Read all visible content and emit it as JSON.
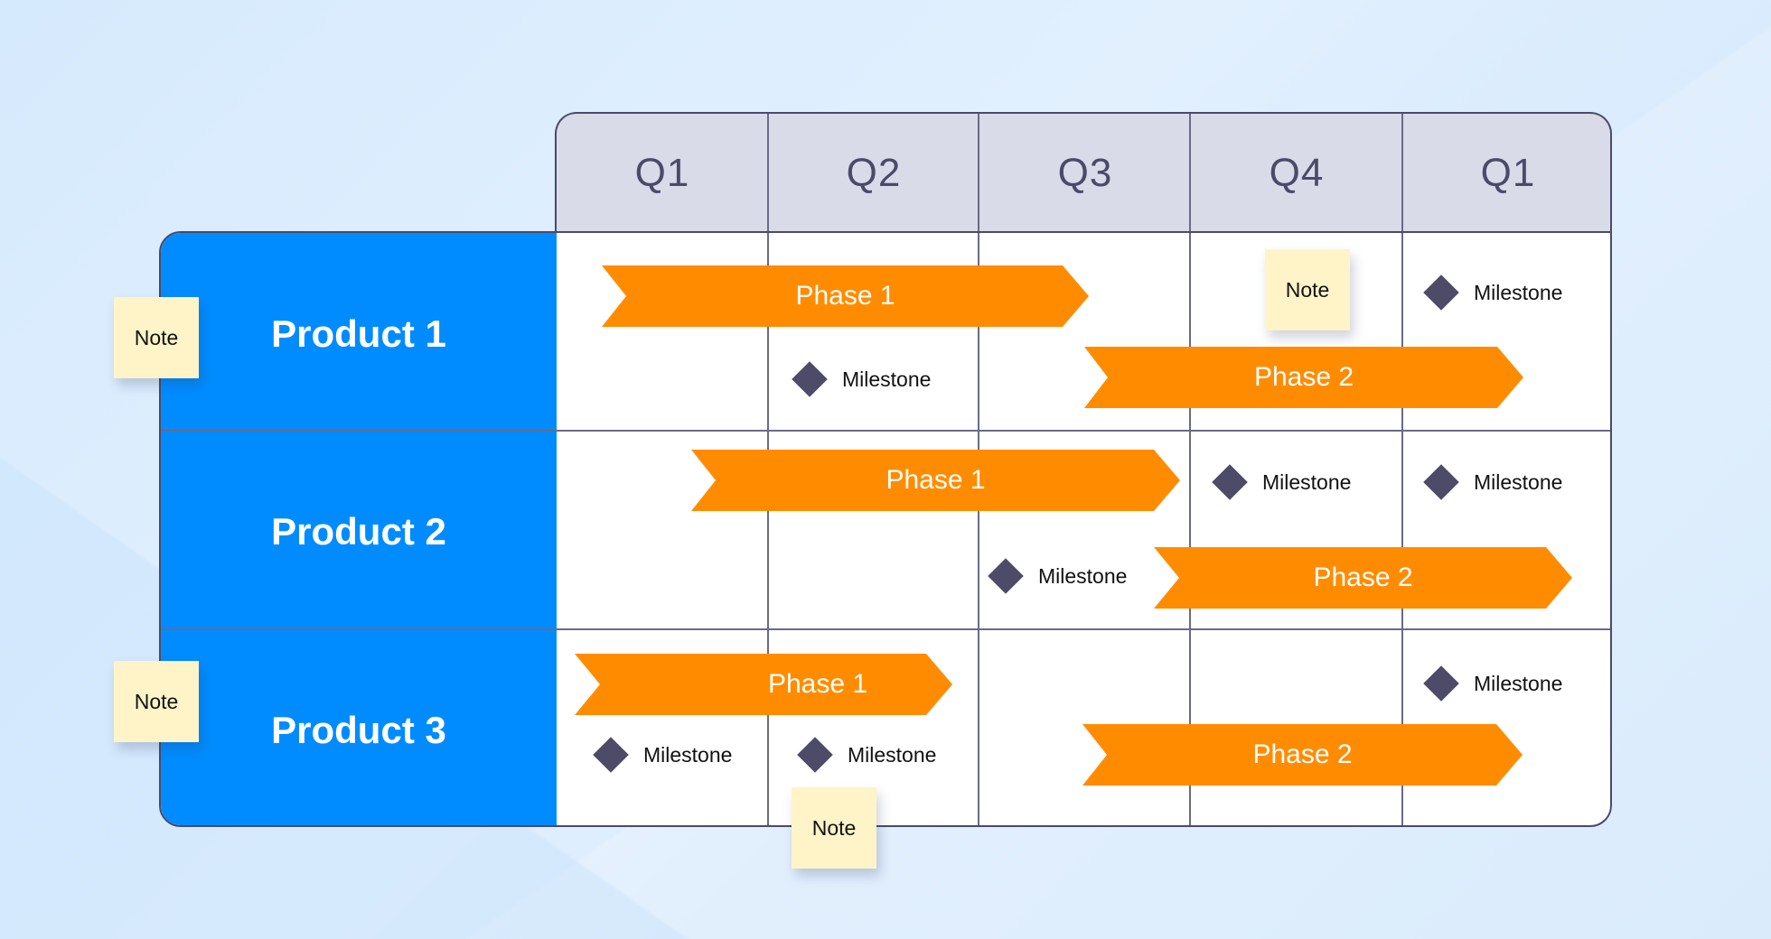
{
  "colors": {
    "product_bg": "#008cff",
    "header_bg": "#d9dbe8",
    "phase_bar": "#ff8c00",
    "milestone": "#4e4b69",
    "note_bg": "#fff4c8",
    "grid_line": "#4b4a6a"
  },
  "header": {
    "columns": [
      "Q1",
      "Q2",
      "Q3",
      "Q4",
      "Q1"
    ]
  },
  "products": [
    {
      "label": "Product 1"
    },
    {
      "label": "Product 2"
    },
    {
      "label": "Product 3"
    }
  ],
  "phases": [
    {
      "product": "Product 1",
      "label": "Phase 1",
      "icon": "chevron-bar"
    },
    {
      "product": "Product 1",
      "label": "Phase 2",
      "icon": "chevron-bar"
    },
    {
      "product": "Product 2",
      "label": "Phase 1",
      "icon": "chevron-bar"
    },
    {
      "product": "Product 2",
      "label": "Phase 2",
      "icon": "chevron-bar"
    },
    {
      "product": "Product 3",
      "label": "Phase 1",
      "icon": "chevron-bar"
    },
    {
      "product": "Product 3",
      "label": "Phase 2",
      "icon": "chevron-bar"
    }
  ],
  "milestones": [
    {
      "product": "Product 1",
      "quarter": "Q2",
      "label": "Milestone",
      "icon": "diamond-icon"
    },
    {
      "product": "Product 1",
      "quarter": "Q1 (next year)",
      "label": "Milestone",
      "icon": "diamond-icon"
    },
    {
      "product": "Product 2",
      "quarter": "Q3",
      "label": "Milestone",
      "icon": "diamond-icon"
    },
    {
      "product": "Product 2",
      "quarter": "Q4",
      "label": "Milestone",
      "icon": "diamond-icon"
    },
    {
      "product": "Product 2",
      "quarter": "Q1 (next year)",
      "label": "Milestone",
      "icon": "diamond-icon"
    },
    {
      "product": "Product 3",
      "quarter": "Q1",
      "label": "Milestone",
      "icon": "diamond-icon"
    },
    {
      "product": "Product 3",
      "quarter": "Q2",
      "label": "Milestone",
      "icon": "diamond-icon"
    },
    {
      "product": "Product 3",
      "quarter": "Q1 (next year)",
      "label": "Milestone",
      "icon": "diamond-icon"
    }
  ],
  "notes": [
    {
      "label": "Note",
      "attached_to": "Product 1"
    },
    {
      "label": "Note",
      "attached_to": "Product 1 / Q4"
    },
    {
      "label": "Note",
      "attached_to": "Product 3"
    },
    {
      "label": "Note",
      "attached_to": "Product 3 / Q2"
    }
  ]
}
